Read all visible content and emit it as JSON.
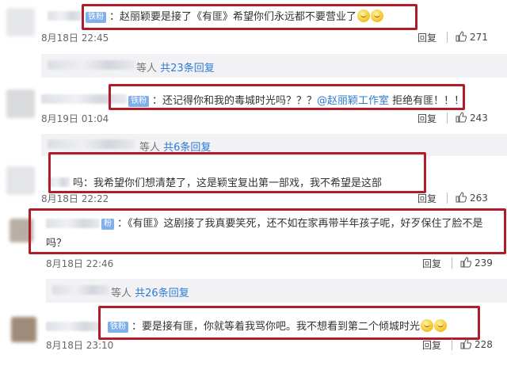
{
  "comments": [
    {
      "badge": "铁粉",
      "text": "：赵丽颖要是接了《有匪》希望你们永远都不要营业了",
      "time": "8月18日 22:45",
      "reply": "回复",
      "likes": "271"
    },
    {
      "badge": "铁粉",
      "text_before": "：还记得你和我的毒城时光吗？？？",
      "mention": "@赵丽颖工作室",
      "text_after": " 拒绝有匪！！！",
      "time": "8月19日 01:04",
      "reply": "回复",
      "likes": "243"
    },
    {
      "text": "吗：我希望你们想清楚了，这是颖宝复出第一部戏，我不希望是这部",
      "time": "8月18日 22:22",
      "reply": "回复",
      "likes": "263"
    },
    {
      "badge": "粉",
      "text_line1": "：《有匪》这剧接了我真要笑死，还不如在家再带半年孩子呢，好歹保住了脸不是",
      "text_line2": "吗？",
      "time": "8月18日 22:46",
      "reply": "回复",
      "likes": "239"
    },
    {
      "badge": "铁粉",
      "text": "：要是接有匪，你就等着我骂你吧。我不想看到第二个倾城时光",
      "time": "8月18日 23:10",
      "reply": "回复",
      "likes": "228"
    }
  ],
  "reply_summaries": [
    {
      "prefix": "等人",
      "count": "共23条回复"
    },
    {
      "prefix": "等人",
      "count": "共6条回复"
    },
    {
      "prefix": "等人",
      "count": "共26条回复"
    }
  ],
  "colors": {
    "highlight_box": "#b21c2a",
    "link": "#2d7ad6",
    "badge": "#7fb0ec"
  }
}
